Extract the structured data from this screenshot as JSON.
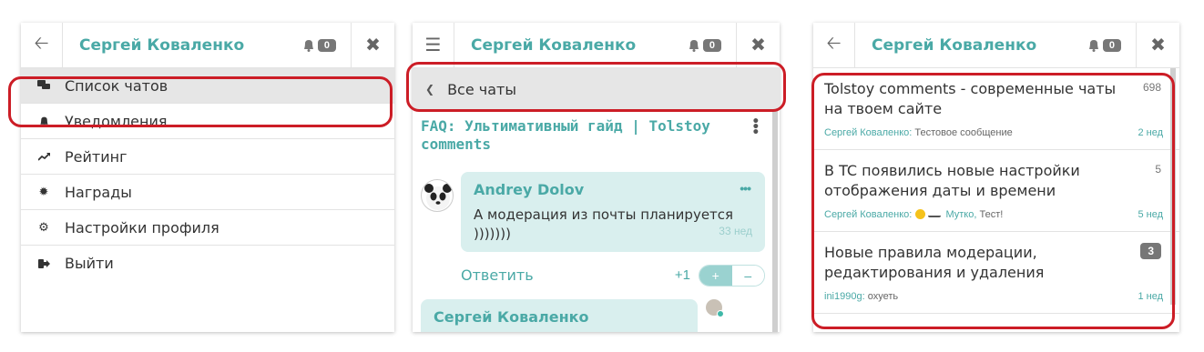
{
  "header": {
    "user_name": "Сергей Коваленко",
    "notif_count": "0"
  },
  "menu": {
    "items": [
      {
        "label": "Список чатов",
        "icon": "chats-icon"
      },
      {
        "label": "Уведомления",
        "icon": "bell-icon"
      },
      {
        "label": "Рейтинг",
        "icon": "trend-icon"
      },
      {
        "label": "Награды",
        "icon": "award-icon"
      },
      {
        "label": "Настройки профиля",
        "icon": "gear-icon"
      },
      {
        "label": "Выйти",
        "icon": "logout-icon"
      }
    ]
  },
  "chat": {
    "back_label": "Все чаты",
    "title": "FAQ: Ультимативный гайд | Tolstoy comments",
    "message": {
      "author": "Andrey Dolov",
      "text": "А модерация из почты планируется )))))))",
      "time": "33 нед"
    },
    "reply_label": "Ответить",
    "score": "+1",
    "vote_plus": "+",
    "vote_minus": "–",
    "next_author": "Сергей Коваленко"
  },
  "chat_list": [
    {
      "title": "Tolstoy comments - современные чаты на твоем сайте",
      "count": "698",
      "last_author": "Сергей Коваленко:",
      "last_text": "Тестовое сообщение",
      "time": "2 нед"
    },
    {
      "title": "В TC появились новые настройки отображения даты и времени",
      "count": "5",
      "last_author": "Сергей Коваленко:",
      "last_mention": "Мутко,",
      "last_text": "Тест!",
      "time": "5 нед"
    },
    {
      "title": "Новые правила модерации, редактирования и удаления",
      "count": "3",
      "last_author": "ini1990g:",
      "last_text": "охуеть",
      "time": "1 нед"
    }
  ],
  "colors": {
    "accent": "#4aa9a6",
    "highlight_ring": "#cc1d26"
  }
}
